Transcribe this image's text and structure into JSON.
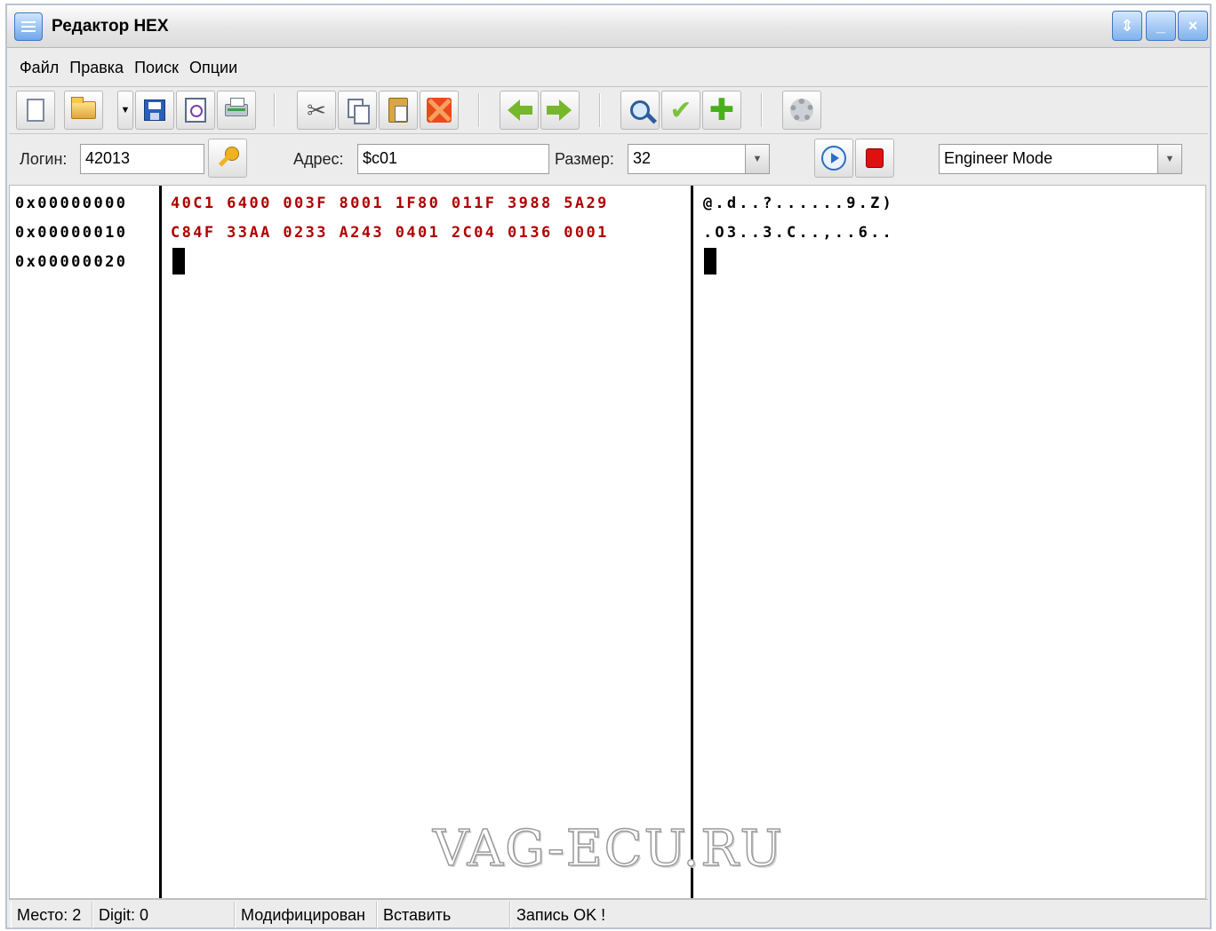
{
  "window": {
    "title": "Редактор HEX"
  },
  "menu": [
    "Файл",
    "Правка",
    "Поиск",
    "Опции"
  ],
  "fields": {
    "login_label": "Логин:",
    "login_value": "42013",
    "address_label": "Адрес:",
    "address_value": "$c01",
    "size_label": "Размер:",
    "size_value": "32",
    "mode_value": "Engineer Mode"
  },
  "editor": {
    "addresses": [
      "0x00000000",
      "0x00000010",
      "0x00000020"
    ],
    "hex_rows": [
      "40C1 6400 003F 8001 1F80 011F 3988 5A29",
      "C84F 33AA 0233 A243 0401 2C04 0136 0001"
    ],
    "ascii_rows": [
      "@.d..?......9.Z)",
      ".O3..3.C..,..6.."
    ]
  },
  "watermark": "VAG-ECU.RU",
  "status": {
    "place": "Место: 2",
    "digit": "Digit: 0",
    "modified": "Модифицирован",
    "insert": "Вставить",
    "write": "Запись  OK !"
  },
  "icons": {
    "toolbar": [
      "new-file-icon",
      "open-folder-icon",
      "save-icon",
      "print-preview-icon",
      "print-icon",
      "cut-icon",
      "copy-icon",
      "paste-icon",
      "delete-icon",
      "back-arrow-icon",
      "forward-arrow-icon",
      "search-icon",
      "check-icon",
      "add-icon",
      "settings-gear-icon"
    ]
  },
  "colors": {
    "hex_text": "#b00000",
    "title_button": "#7fb2ec"
  }
}
